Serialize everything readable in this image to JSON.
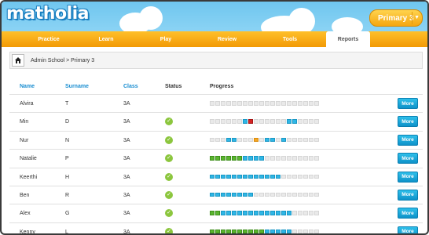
{
  "header": {
    "logo": "matholia",
    "level_selector": "Primary 3"
  },
  "nav": {
    "items": [
      "Practice",
      "Learn",
      "Play",
      "Review",
      "Tools"
    ],
    "active": "Reports"
  },
  "breadcrumb": "Admin School > Primary 3",
  "table": {
    "headers": {
      "name": "Name",
      "surname": "Surname",
      "class": "Class",
      "status": "Status",
      "progress": "Progress"
    },
    "more_label": "More",
    "rows": [
      {
        "name": "Alvira",
        "surname": "T",
        "class": "3A",
        "status": "none",
        "progress": "eeeeeeeeeeeeeeeeeeee"
      },
      {
        "name": "Min",
        "surname": "D",
        "class": "3A",
        "status": "done",
        "progress": "eeeeeebreeeeeebbeeee"
      },
      {
        "name": "Nur",
        "surname": "N",
        "class": "3A",
        "status": "done",
        "progress": "eeebbeeeoebbebeeeeee"
      },
      {
        "name": "Natalie",
        "surname": "P",
        "class": "3A",
        "status": "done",
        "progress": "ggggggbbbbeeeeeeeeee"
      },
      {
        "name": "Keerthi",
        "surname": "H",
        "class": "3A",
        "status": "done",
        "progress": "bbbbbbbbbbbbbeeeeeee"
      },
      {
        "name": "Ben",
        "surname": "R",
        "class": "3A",
        "status": "done",
        "progress": "bbbbbbbbeeeeeeeeeeee"
      },
      {
        "name": "Alex",
        "surname": "G",
        "class": "3A",
        "status": "done",
        "progress": "ggbbbbbbbbbbbbbeeeee"
      },
      {
        "name": "Kenny",
        "surname": "L",
        "class": "3A",
        "status": "done",
        "progress": "ggggggggggbbbbbeeeee"
      }
    ]
  },
  "colors": {
    "accent_blue": "#1a8ed1",
    "nav_orange": "#f29a06",
    "complete_green": "#5ab52e",
    "progress_blue": "#2eb6e6",
    "error_red": "#d42323",
    "warn_orange": "#f5a623"
  },
  "icons": {
    "home": "home-icon",
    "status": "check-circle-icon",
    "dropdown": "chevron-down-icon"
  }
}
